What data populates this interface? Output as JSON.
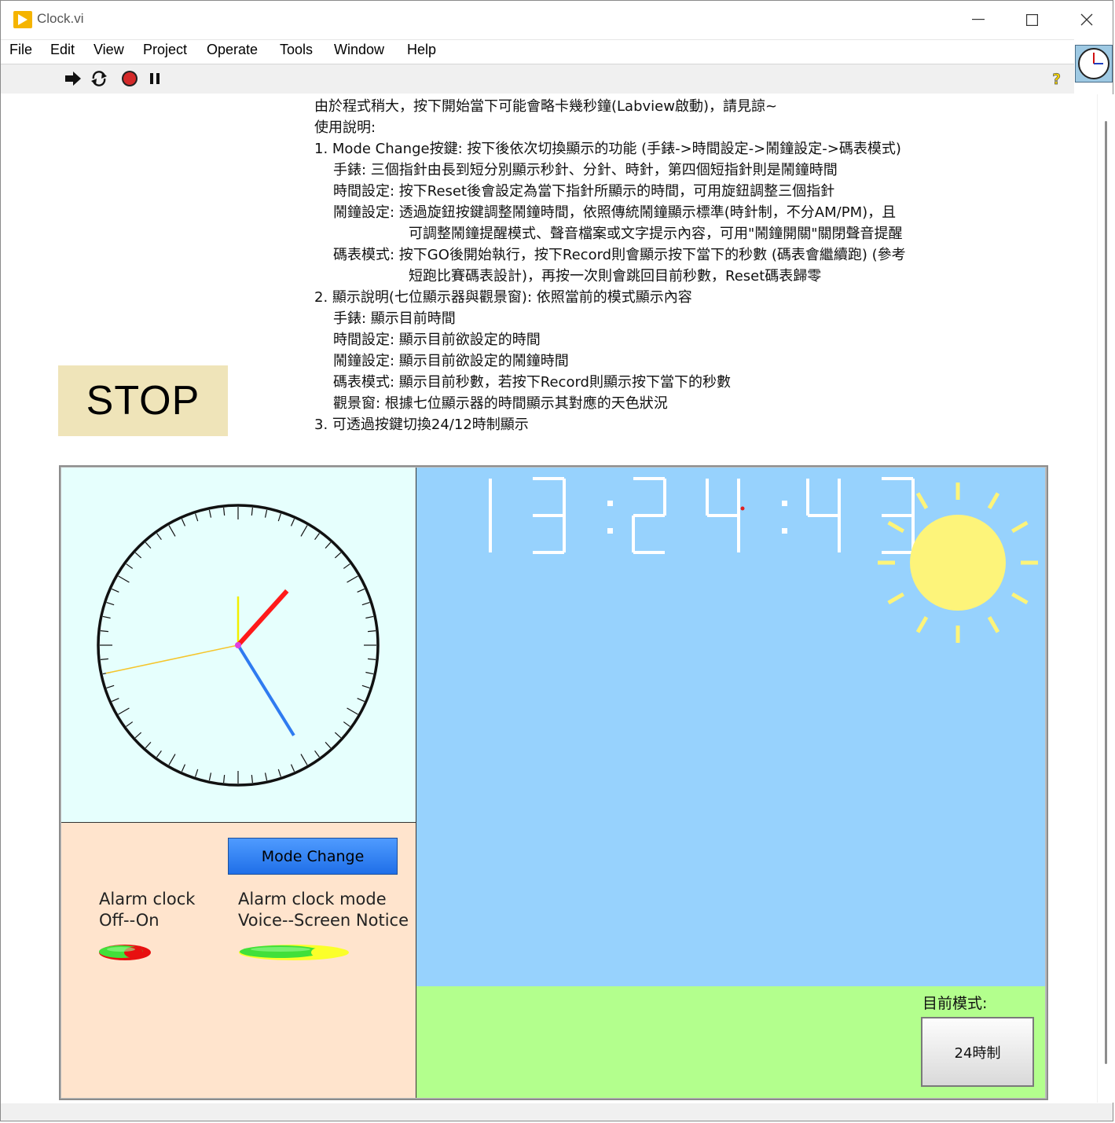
{
  "window": {
    "title": "Clock.vi"
  },
  "menu": {
    "items": [
      "File",
      "Edit",
      "View",
      "Project",
      "Operate",
      "Tools",
      "Window",
      "Help"
    ]
  },
  "toolbar": {
    "icons": [
      "run-arrow-icon",
      "run-continuously-icon",
      "abort-icon",
      "pause-icon",
      "context-help-icon"
    ]
  },
  "panel": {
    "stop_label": "STOP",
    "instructions": [
      {
        "level": 0,
        "text": "由於程式稍大，按下開始當下可能會略卡幾秒鐘(Labview啟動)，請見諒~"
      },
      {
        "level": 0,
        "text": "使用說明:"
      },
      {
        "level": 0,
        "text": "1. Mode Change按鍵: 按下後依次切換顯示的功能 (手錶->時間設定->鬧鐘設定->碼表模式)"
      },
      {
        "level": 1,
        "text": "手錶: 三個指針由長到短分別顯示秒針、分針、時針，第四個短指針則是鬧鐘時間"
      },
      {
        "level": 1,
        "text": "時間設定: 按下Reset後會設定為當下指針所顯示的時間，可用旋鈕調整三個指針"
      },
      {
        "level": 1,
        "text": "鬧鐘設定: 透過旋鈕按鍵調整鬧鐘時間，依照傳統鬧鐘顯示標準(時針制，不分AM/PM)，且"
      },
      {
        "level": 2,
        "text": "可調整鬧鐘提醒模式、聲音檔案或文字提示內容，可用\"鬧鐘開關\"關閉聲音提醒"
      },
      {
        "level": 1,
        "text": "碼表模式: 按下GO後開始執行，按下Record則會顯示按下當下的秒數 (碼表會繼續跑) (參考"
      },
      {
        "level": 2,
        "text": "短跑比賽碼表設計)，再按一次則會跳回目前秒數，Reset碼表歸零"
      },
      {
        "level": 0,
        "text": "2. 顯示說明(七位顯示器與觀景窗): 依照當前的模式顯示內容"
      },
      {
        "level": 1,
        "text": "手錶: 顯示目前時間"
      },
      {
        "level": 1,
        "text": "時間設定: 顯示目前欲設定的時間"
      },
      {
        "level": 1,
        "text": "鬧鐘設定: 顯示目前欲設定的鬧鐘時間"
      },
      {
        "level": 1,
        "text": "碼表模式: 顯示目前秒數，若按下Record則顯示按下當下的秒數"
      },
      {
        "level": 1,
        "text": "觀景窗: 根據七位顯示器的時間顯示其對應的天色狀況"
      },
      {
        "level": 0,
        "text": "3. 可透過按鍵切換24/12時制顯示"
      }
    ],
    "clock": {
      "hour": 13,
      "minute": 24,
      "second": 43,
      "colors": {
        "hour_hand": "#ff1a1a",
        "minute_hand": "#2f7bf0",
        "second_hand": "#f5c52b",
        "alarm_hand": "#f2ef00",
        "center": "#e040e0"
      }
    },
    "seven_segment": {
      "digits": "13:24:43",
      "color": "#ffffff"
    },
    "controls": {
      "mode_change_label": "Mode Change",
      "alarm_clock_label": "Alarm clock\nOff--On",
      "alarm_mode_label": "Alarm clock mode\nVoice--Screen Notice"
    },
    "view_window": {
      "sky_color": "#97d2fd",
      "ground_color": "#b3ff8d",
      "sun_color": "#fdf47a",
      "weather_icon": "sun-icon"
    },
    "mode_display": {
      "label": "目前模式:",
      "value": "24時制"
    }
  }
}
